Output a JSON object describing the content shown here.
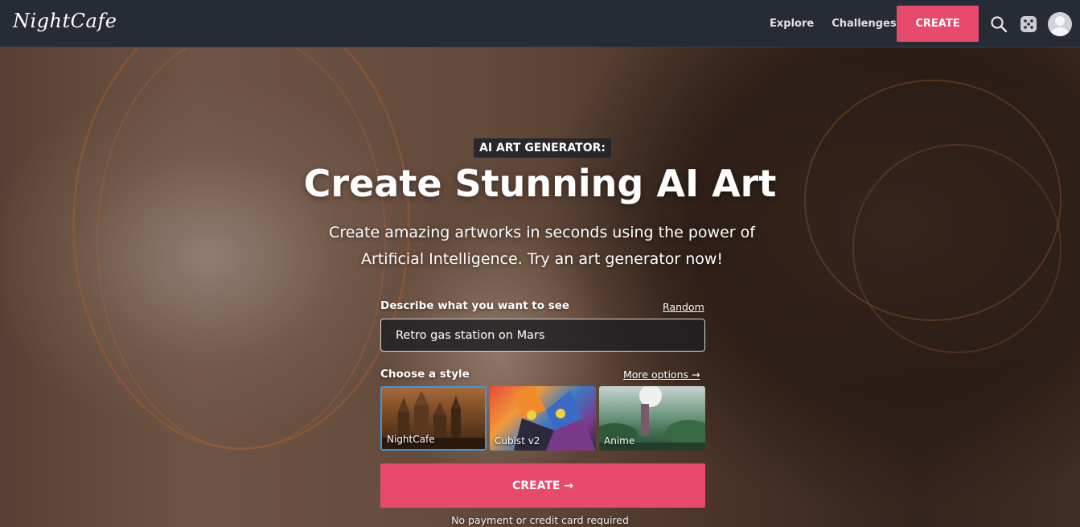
{
  "navbar": {
    "logo": "NightCafe",
    "links": [
      "Explore",
      "Challenges"
    ],
    "create_label": "CREATE"
  },
  "hero": {
    "eyebrow": "AI ART GENERATOR:",
    "headline": "Create Stunning AI Art",
    "subtitle": "Create amazing artworks in seconds using the power of Artificial Intelligence. Try an art generator now!"
  },
  "form": {
    "describe_label": "Describe what you want to see",
    "random_link": "Random",
    "prompt_value": "Retro gas station on Mars",
    "style_label": "Choose a style",
    "more_options": "More options →",
    "styles": [
      {
        "name": "NightCafe",
        "selected": true
      },
      {
        "name": "Cubist v2",
        "selected": false
      },
      {
        "name": "Anime",
        "selected": false
      }
    ],
    "create_label": "CREATE →",
    "footnote": "No payment or credit card required"
  },
  "colors": {
    "accent": "#e84a6b",
    "navbar": "#262b34",
    "selected_border": "#3a9bdc"
  },
  "icons": [
    "search-icon",
    "dice-icon",
    "avatar"
  ]
}
